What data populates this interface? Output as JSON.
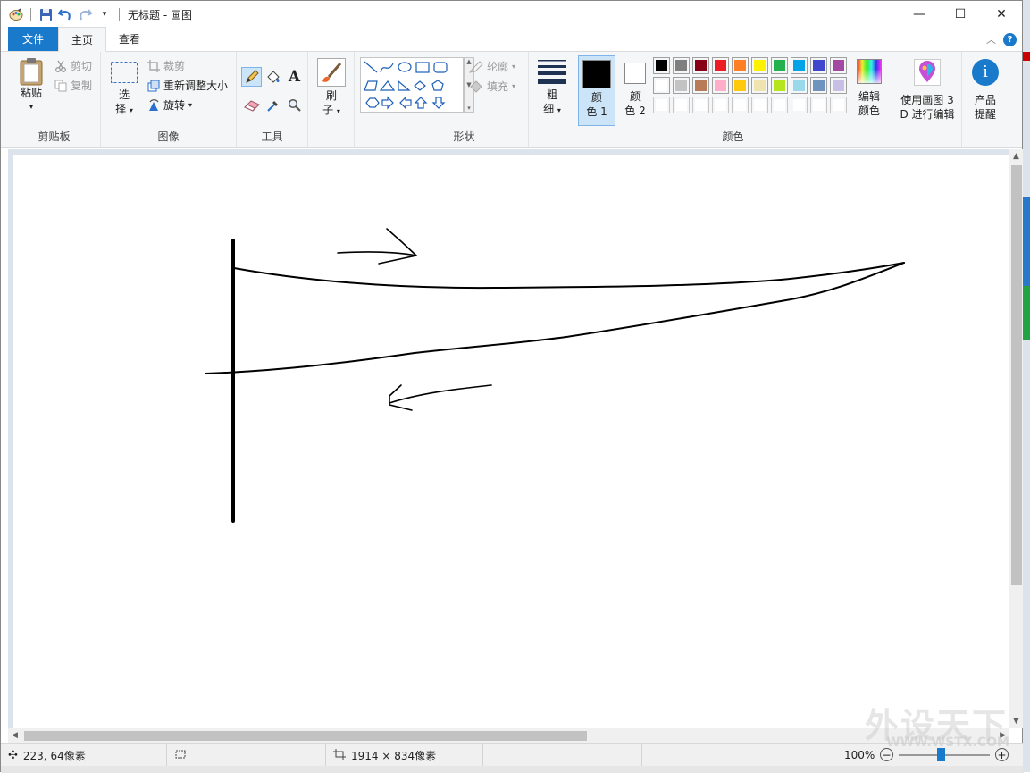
{
  "window": {
    "title": "无标题 - 画图",
    "minimize": "—",
    "maximize": "☐",
    "close": "✕"
  },
  "tabs": [
    {
      "label": "文件"
    },
    {
      "label": "主页"
    },
    {
      "label": "查看"
    }
  ],
  "clipboard": {
    "group_label": "剪贴板",
    "paste": "粘贴",
    "cut": "剪切",
    "copy": "复制"
  },
  "image": {
    "group_label": "图像",
    "select_line1": "选",
    "select_line2": "择",
    "crop": "裁剪",
    "resize": "重新调整大小",
    "rotate": "旋转"
  },
  "tools": {
    "group_label": "工具",
    "text_tool": "A"
  },
  "brushes": {
    "line1": "刷",
    "line2": "子"
  },
  "shapes": {
    "group_label": "形状",
    "outline": "轮廓",
    "fill": "填充"
  },
  "size": {
    "line1": "粗",
    "line2": "细"
  },
  "colors": {
    "group_label": "颜色",
    "color1_line1": "颜",
    "color1_line2": "色 1",
    "color2_line1": "颜",
    "color2_line2": "色 2",
    "edit_line1": "编辑",
    "edit_line2": "颜色",
    "color1_value": "#000000",
    "color2_value": "#ffffff",
    "palette_row1": [
      "#000000",
      "#7f7f7f",
      "#880015",
      "#ed1c24",
      "#ff7f27",
      "#fff200",
      "#22b14c",
      "#00a2e8",
      "#3f48cc",
      "#a349a4"
    ],
    "palette_row2": [
      "#ffffff",
      "#c3c3c3",
      "#b97a57",
      "#ffaec9",
      "#ffc90e",
      "#efe4b0",
      "#b5e61d",
      "#99d9ea",
      "#7092be",
      "#c8bfe7"
    ],
    "palette_row3": [
      "#ffffff",
      "#ffffff",
      "#ffffff",
      "#ffffff",
      "#ffffff",
      "#ffffff",
      "#ffffff",
      "#ffffff",
      "#ffffff",
      "#ffffff"
    ]
  },
  "paint3d": {
    "line1": "使用画图 3",
    "line2": "D 进行编辑"
  },
  "product_alert": {
    "line1": "产品",
    "line2": "提醒"
  },
  "status": {
    "cursor_pos": "223, 64像素",
    "canvas_size": "1914 × 834像素",
    "zoom": "100%"
  },
  "watermark": {
    "big": "外设天下",
    "small": "WWW.WSTX.COM"
  }
}
